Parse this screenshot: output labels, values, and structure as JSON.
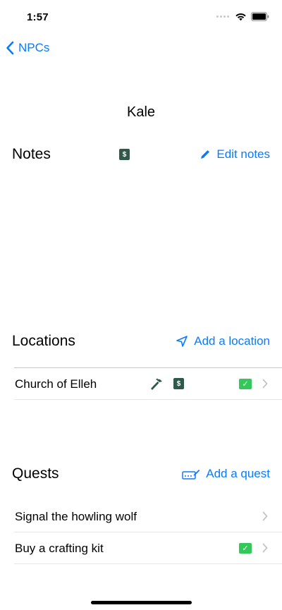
{
  "status": {
    "time": "1:57"
  },
  "nav": {
    "back_label": "NPCs"
  },
  "title": "Kale",
  "notes": {
    "heading": "Notes",
    "action_label": "Edit notes",
    "icon": "pencil-icon"
  },
  "locations": {
    "heading": "Locations",
    "action_label": "Add a location",
    "icon": "location-arrow-icon",
    "items": [
      {
        "label": "Church of Elleh",
        "hammer": true,
        "money": true,
        "checked": true
      }
    ]
  },
  "quests": {
    "heading": "Quests",
    "action_label": "Add a quest",
    "icon": "signature-icon",
    "items": [
      {
        "label": "Signal the howling wolf",
        "checked": false
      },
      {
        "label": "Buy a crafting kit",
        "checked": true
      }
    ]
  },
  "badges": {
    "money_symbol": "$",
    "check_symbol": "✓"
  },
  "colors": {
    "accent": "#0a7aff",
    "money_badge": "#2f5a4a",
    "check_badge": "#34c759"
  }
}
